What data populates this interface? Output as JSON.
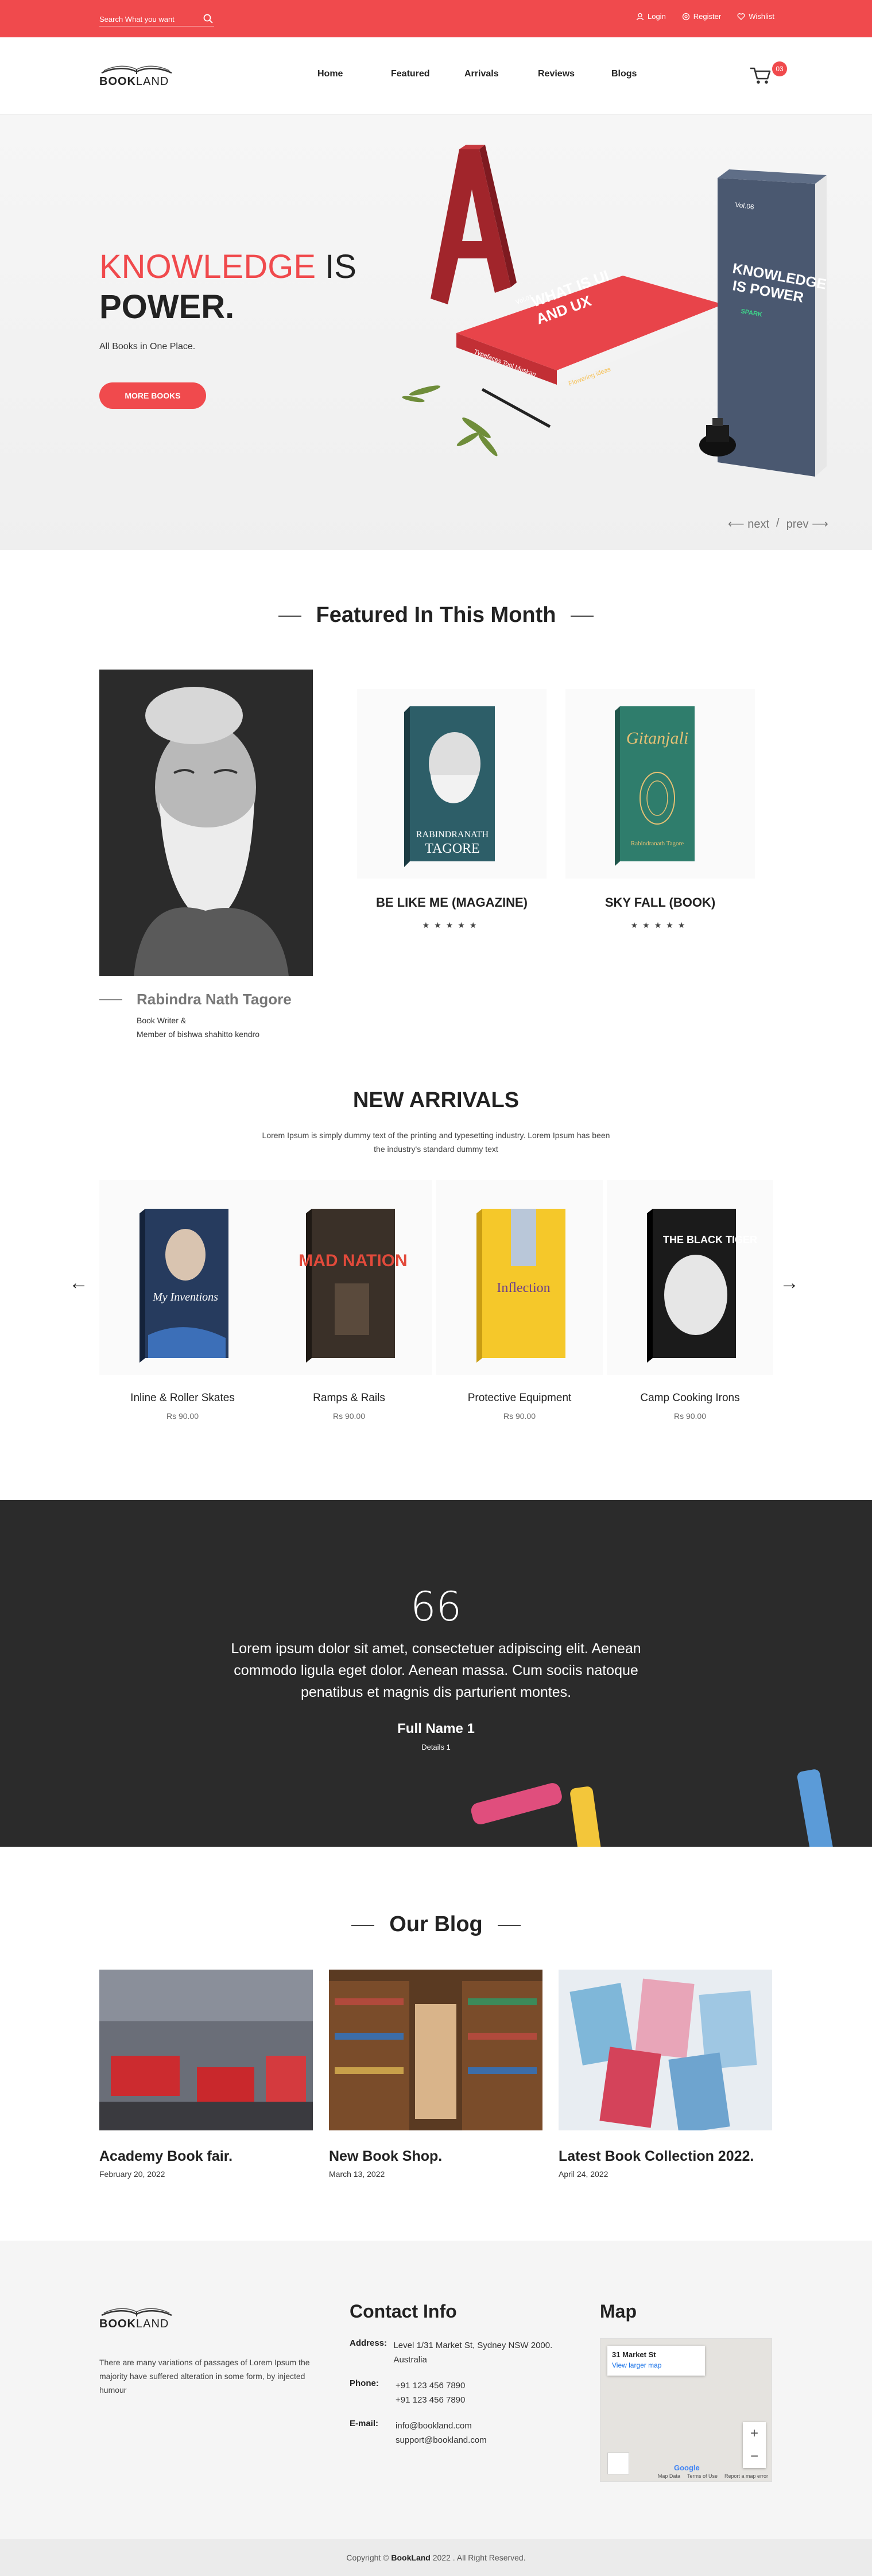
{
  "topbar": {
    "search_placeholder": "Search What you want",
    "links": [
      {
        "label": "Login",
        "icon": "user-icon"
      },
      {
        "label": "Register",
        "icon": "register-icon"
      },
      {
        "label": "Wishlist",
        "icon": "heart-icon"
      }
    ]
  },
  "header": {
    "logo_bold": "BOOK",
    "logo_light": "LAND",
    "nav": [
      "Home",
      "Featured",
      "Arrivals",
      "Reviews",
      "Blogs"
    ],
    "cart_count": "03"
  },
  "hero": {
    "title_red": "KNOWLEDGE",
    "title_is": "IS",
    "title_bold": "POWER.",
    "subtitle": "All Books in One Place.",
    "button": "MORE BOOKS",
    "book1_lines": [
      "WHAT IS UI",
      "AND UX"
    ],
    "book1_vol": "Vol.01",
    "book1_spine": "Typefaces Tool Muskan",
    "book1_edition": "Flowering ideas",
    "book2_vol": "Vol.06",
    "book2_lines": [
      "KNOWLEDGE",
      "IS POWER"
    ],
    "book2_tag": "SPARK",
    "nav_next": "next",
    "nav_prev": "prev",
    "slash": "/"
  },
  "featured": {
    "title": "Featured In This Month",
    "author_name": "Rabindra Nath Tagore",
    "author_role_1": "Book Writer &",
    "author_role_2": "Member of bishwa shahitto kendro",
    "books": [
      {
        "title": "BE LIKE ME (MAGAZINE)",
        "cover_lines": [
          "RABINDRANATH",
          "TAGORE"
        ],
        "stars": "★★★★★"
      },
      {
        "title": "SKY FALL (BOOK)",
        "cover_lines": [
          "Gitanjali",
          "Rabindranath Tagore"
        ],
        "stars": "★★★★★"
      }
    ]
  },
  "arrivals": {
    "title": "NEW ARRIVALS",
    "description": "Lorem Ipsum is simply dummy text of the printing and typesetting industry. Lorem Ipsum has been the industry's standard dummy text",
    "prev_arrow": "←",
    "next_arrow": "→",
    "books": [
      {
        "title": "Inline & Roller Skates",
        "price": "Rs 90.00",
        "cover_text": "My Inventions"
      },
      {
        "title": "Ramps & Rails",
        "price": "Rs 90.00",
        "cover_text": "MAD NATION"
      },
      {
        "title": "Protective Equipment",
        "price": "Rs 90.00",
        "cover_text": "Inflection"
      },
      {
        "title": "Camp Cooking Irons",
        "price": "Rs 90.00",
        "cover_text": "THE BLACK TIGER"
      }
    ]
  },
  "testimonial": {
    "quote_mark": "66",
    "text": "Lorem ipsum dolor sit amet, consectetuer adipiscing elit. Aenean commodo ligula eget dolor. Aenean massa. Cum sociis natoque penatibus et magnis dis parturient montes.",
    "name": "Full Name 1",
    "details": "Details 1"
  },
  "blog": {
    "title": "Our Blog",
    "posts": [
      {
        "title": "Academy Book fair.",
        "date": "February 20, 2022"
      },
      {
        "title": "New Book Shop.",
        "date": "March 13, 2022"
      },
      {
        "title": "Latest Book Collection 2022.",
        "date": "April 24, 2022"
      }
    ]
  },
  "footer": {
    "logo_bold": "BOOK",
    "logo_light": "LAND",
    "description": "There are many variations of passages of Lorem Ipsum the majority have suffered alteration in some form, by injected humour",
    "contact_title": "Contact Info",
    "address_label": "Address:",
    "address": "Level 1/31 Market St, Sydney NSW 2000. Australia",
    "phone_label": "Phone:",
    "phone_1": "+91 123 456 7890",
    "phone_2": "+91 123 456 7890",
    "email_label": "E-mail:",
    "email_1": "info@bookland.com",
    "email_2": "support@bookland.com",
    "map_title": "Map",
    "map_place": "31 Market St",
    "map_link": "View larger map",
    "map_zoom_in": "+",
    "map_zoom_out": "−",
    "map_google": "Google",
    "map_footer": [
      "Map Data",
      "Terms of Use",
      "Report a map error"
    ]
  },
  "copyright": {
    "prefix": "Copyright © ",
    "brand": "BookLand",
    "suffix": " 2022 . All Right Reserved."
  }
}
